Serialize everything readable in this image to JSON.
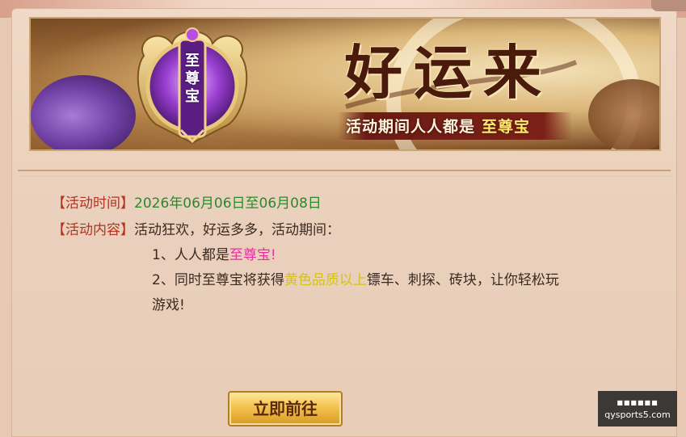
{
  "banner": {
    "emblem_text": "至尊宝",
    "title": "好运来",
    "subtitle_prefix": "活动期间人人都是",
    "subtitle_highlight": "至尊宝"
  },
  "event": {
    "time_tag": "【活动时间】",
    "time_value": "2026年06月06日至06月08日",
    "content_tag": "【活动内容】",
    "content_intro": "活动狂欢，好运多多，活动期间：",
    "line1_prefix": "1、人人都是",
    "line1_highlight": "至尊宝!",
    "line2_prefix": "2、同时至尊宝将获得",
    "line2_highlight": "黄色品质以上",
    "line2_suffix": "镖车、刺探、砖块，让你轻松玩",
    "line3": "游戏!"
  },
  "button": {
    "label": "立即前往"
  },
  "watermark": {
    "site": "qysports5.com",
    "dots": "■■■■■■"
  },
  "colors": {
    "tag": "#b3331f",
    "date": "#2a8a2a",
    "pink_highlight": "#e2319e",
    "yellow_highlight": "#d6c311"
  }
}
